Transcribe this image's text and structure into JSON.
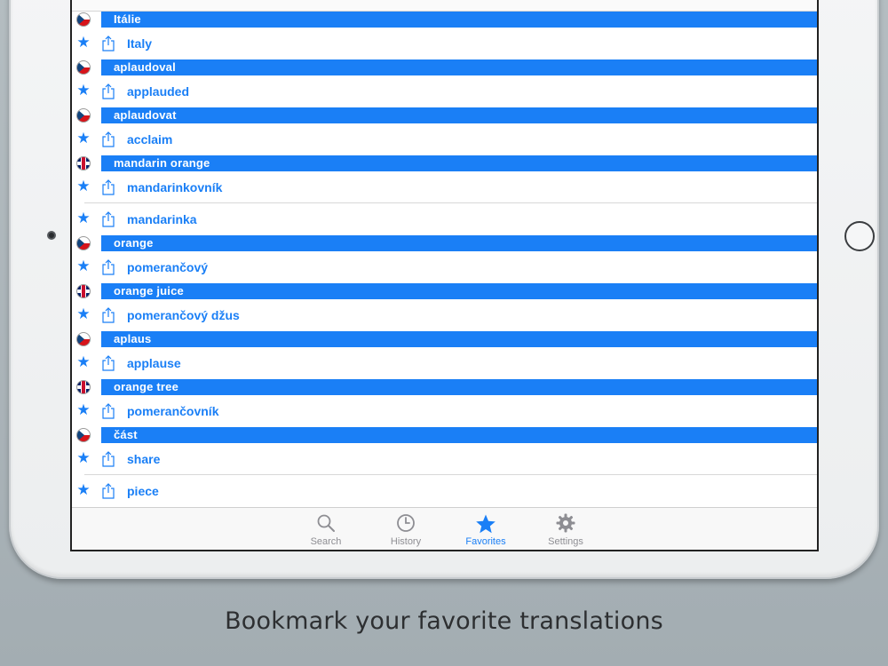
{
  "rows": [
    {
      "type": "header",
      "flag": "czech-flag",
      "text": "Itálie"
    },
    {
      "type": "item",
      "text": "Italy"
    },
    {
      "type": "header",
      "flag": "czech-flag",
      "text": "aplaudoval"
    },
    {
      "type": "item",
      "text": "applauded"
    },
    {
      "type": "header",
      "flag": "czech-flag",
      "text": "aplaudovat"
    },
    {
      "type": "item",
      "text": "acclaim"
    },
    {
      "type": "header",
      "flag": "uk-flag",
      "text": "mandarin orange"
    },
    {
      "type": "item",
      "text": "mandarinkovník",
      "separator": true
    },
    {
      "type": "item",
      "text": "mandarinka"
    },
    {
      "type": "header",
      "flag": "czech-flag",
      "text": "orange"
    },
    {
      "type": "item",
      "text": "pomerančový"
    },
    {
      "type": "header",
      "flag": "uk-flag",
      "text": "orange juice"
    },
    {
      "type": "item",
      "text": "pomerančový džus"
    },
    {
      "type": "header",
      "flag": "czech-flag",
      "text": "aplaus"
    },
    {
      "type": "item",
      "text": "applause"
    },
    {
      "type": "header",
      "flag": "uk-flag",
      "text": "orange tree"
    },
    {
      "type": "item",
      "text": "pomerančovník"
    },
    {
      "type": "header",
      "flag": "czech-flag",
      "text": "část"
    },
    {
      "type": "item",
      "text": "share",
      "separator": true
    },
    {
      "type": "item",
      "text": "piece"
    }
  ],
  "tabbar": {
    "search": {
      "label": "Search",
      "icon": "search-icon"
    },
    "history": {
      "label": "History",
      "icon": "clock-icon"
    },
    "favorites": {
      "label": "Favorites",
      "icon": "star-icon",
      "active": true
    },
    "settings": {
      "label": "Settings",
      "icon": "gear-icon"
    }
  },
  "caption": "Bookmark your favorite translations",
  "colors": {
    "accent": "#1a7ff6",
    "tab_inactive": "#8e8e93",
    "background": "#aab3b8",
    "caption": "#2d2f31"
  }
}
